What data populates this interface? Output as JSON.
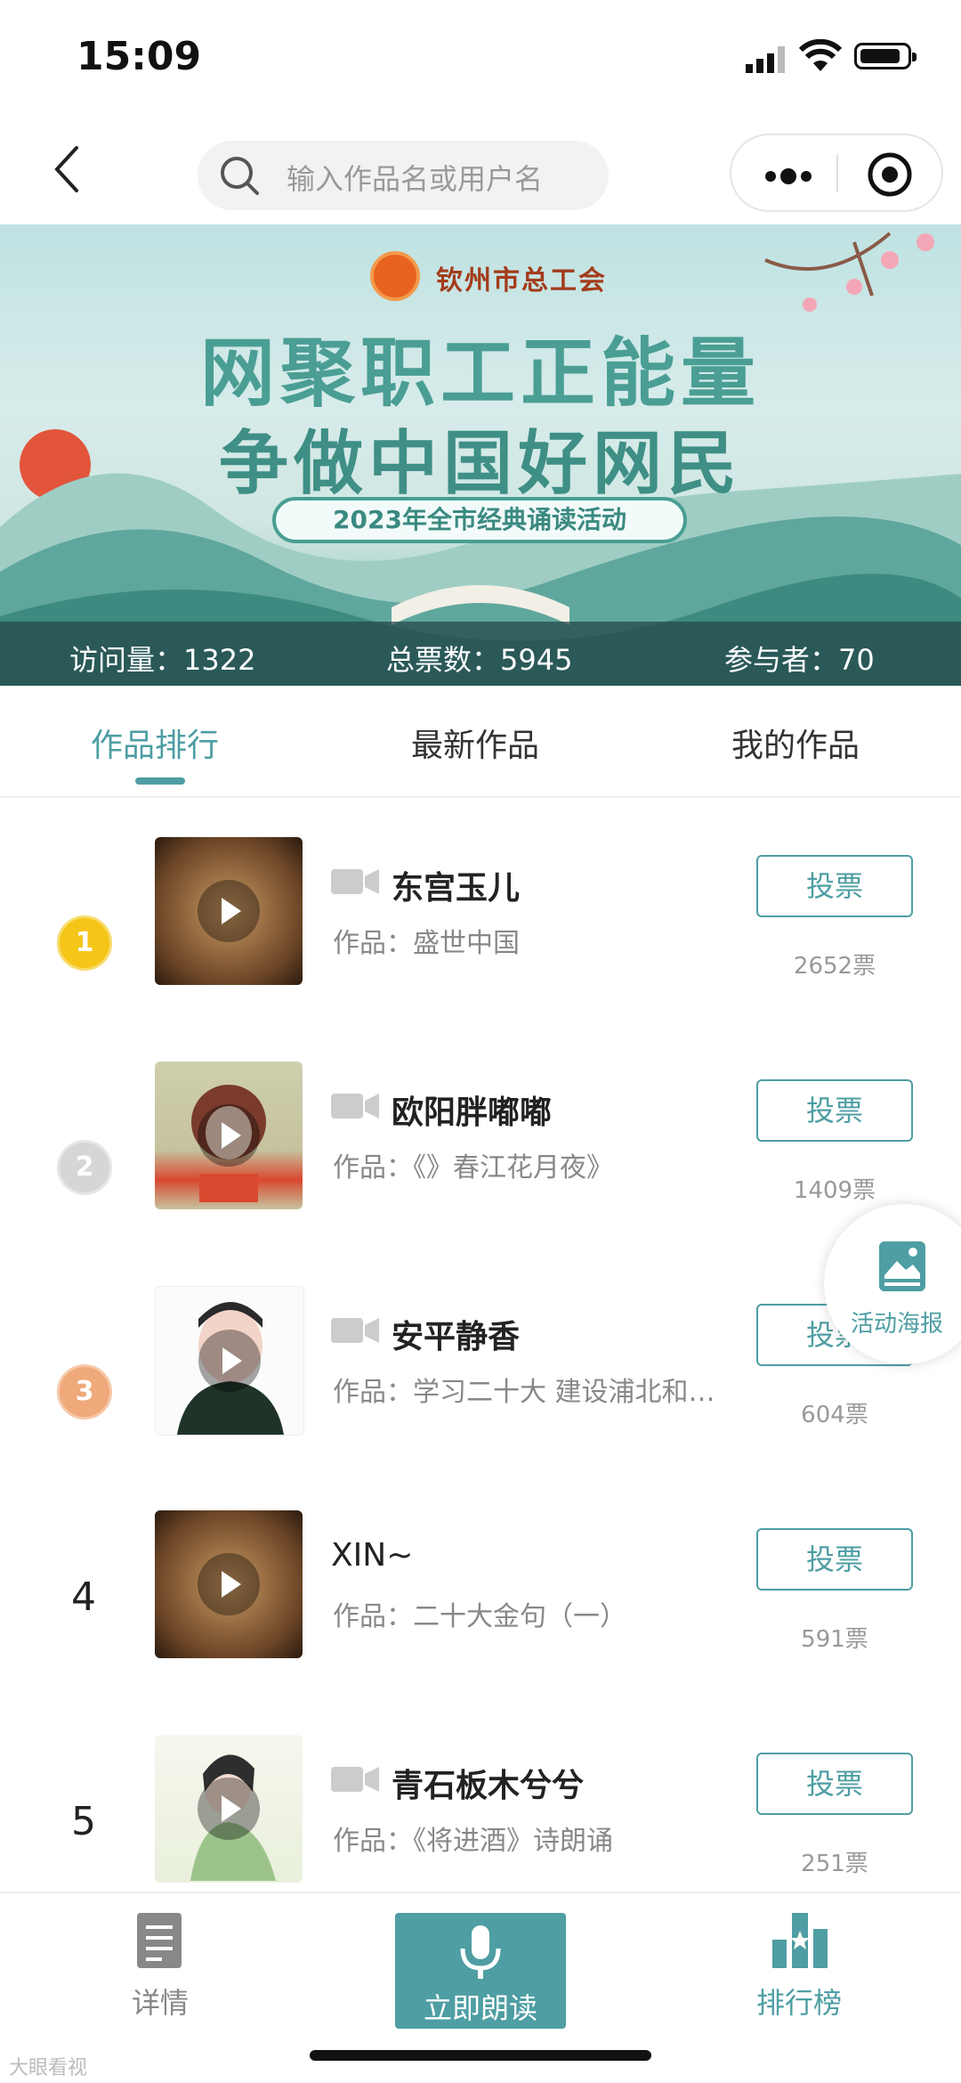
{
  "status_bar": {
    "time": "15:09"
  },
  "search": {
    "placeholder": "输入作品名或用户名"
  },
  "banner": {
    "org": "钦州市总工会",
    "slogan_line1": "网聚职工正能量",
    "slogan_line2": "争做中国好网民",
    "subtitle": "2023年全市经典诵读活动",
    "stats": {
      "visits": "访问量：1322",
      "total_votes": "总票数：5945",
      "participants": "参与者：70"
    }
  },
  "tabs": [
    {
      "label": "作品排行",
      "active": true
    },
    {
      "label": "最新作品",
      "active": false
    },
    {
      "label": "我的作品",
      "active": false
    }
  ],
  "vote_label": "投票",
  "entries": [
    {
      "rank": "1",
      "name": "东宫玉儿",
      "work": "作品：盛世中国",
      "votes": "2652票",
      "has_video_icon": true
    },
    {
      "rank": "2",
      "name": "欧阳胖嘟嘟",
      "work": "作品：《》春江花月夜》",
      "votes": "1409票",
      "has_video_icon": true
    },
    {
      "rank": "3",
      "name": "安平静香",
      "work": "作品：学习二十大 建设浦北和…",
      "votes": "604票",
      "has_video_icon": true
    },
    {
      "rank": "4",
      "name": "XIN~",
      "work": "作品：二十大金句（一）",
      "votes": "591票",
      "has_video_icon": false
    },
    {
      "rank": "5",
      "name": "青石板木兮兮",
      "work": "作品：《将进酒》诗朗诵",
      "votes": "251票",
      "has_video_icon": true
    }
  ],
  "floating": {
    "poster_label": "活动海报"
  },
  "bottom_nav": {
    "details": "详情",
    "record": "立即朗读",
    "ranking": "排行榜"
  },
  "watermark": "大眼看视",
  "colors": {
    "accent": "#4e9ea3",
    "gold": "#f5c518",
    "silver": "#cfcfcf",
    "bronze": "#f0a97a"
  }
}
